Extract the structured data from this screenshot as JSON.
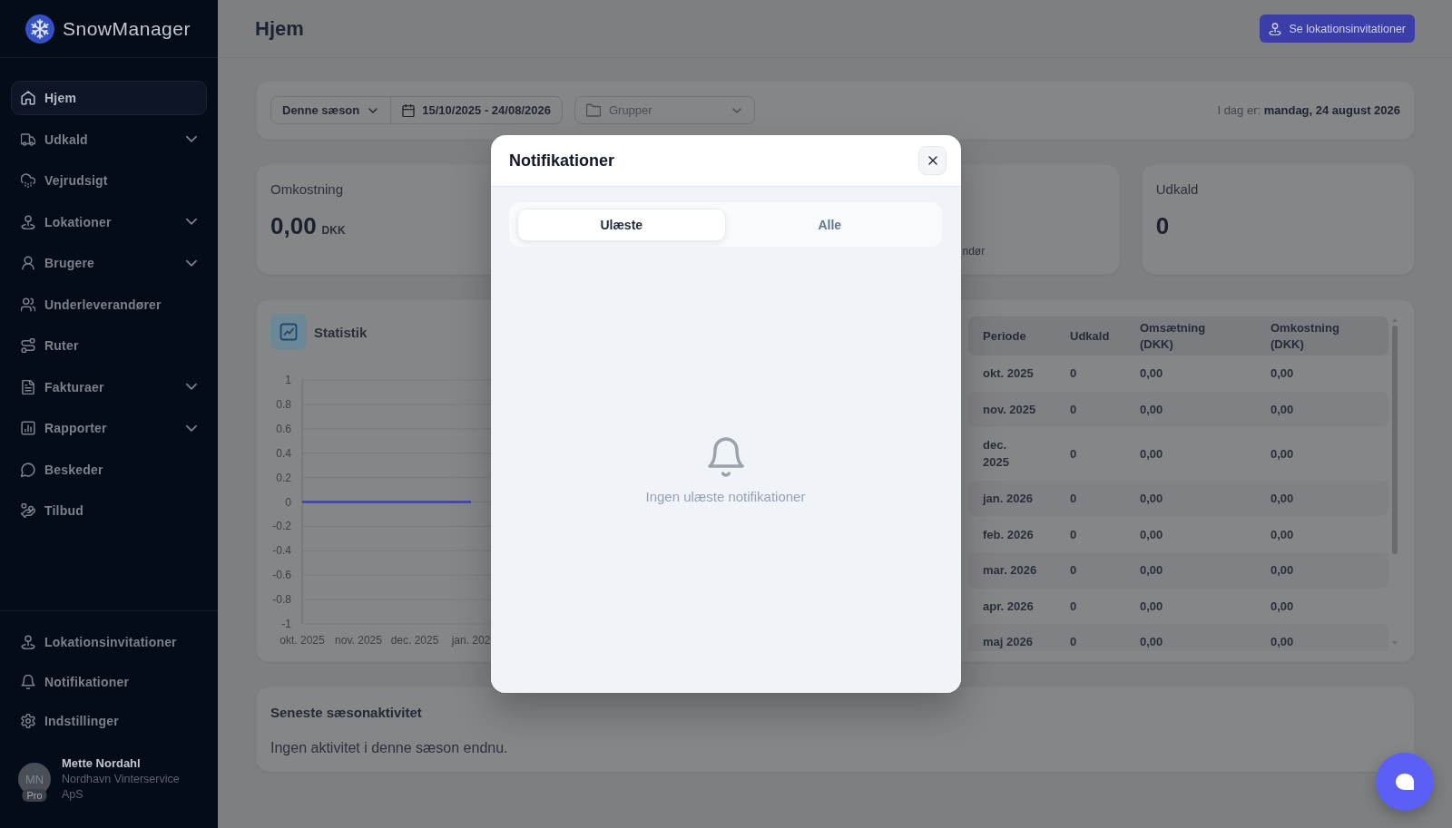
{
  "sidebar": {
    "brand": "SnowManager",
    "nav": [
      {
        "label": "Hjem",
        "selected": true,
        "has_submenu": false
      },
      {
        "label": "Udkald",
        "selected": false,
        "has_submenu": true
      },
      {
        "label": "Vejrudsigt",
        "selected": false,
        "has_submenu": false
      },
      {
        "label": "Lokationer",
        "selected": false,
        "has_submenu": true
      },
      {
        "label": "Brugere",
        "selected": false,
        "has_submenu": true
      },
      {
        "label": "Underleverandører",
        "selected": false,
        "has_submenu": false
      },
      {
        "label": "Ruter",
        "selected": false,
        "has_submenu": false
      },
      {
        "label": "Fakturaer",
        "selected": false,
        "has_submenu": true
      },
      {
        "label": "Rapporter",
        "selected": false,
        "has_submenu": true
      },
      {
        "label": "Beskeder",
        "selected": false,
        "has_submenu": false
      },
      {
        "label": "Tilbud",
        "selected": false,
        "has_submenu": false
      }
    ],
    "bottom_nav": [
      {
        "label": "Lokationsinvitationer",
        "selected": false
      },
      {
        "label": "Notifikationer",
        "selected": false
      },
      {
        "label": "Indstillinger",
        "selected": false
      }
    ],
    "user": {
      "initials": "MN",
      "plan": "Pro",
      "name": "Mette Nordahl",
      "company": "Nordhavn Vinterservice ApS"
    }
  },
  "header": {
    "title": "Hjem",
    "button": "Se lokationsinvitationer"
  },
  "filters": {
    "season": "Denne sæson",
    "date_range": "15/10/2025 - 24/08/2026",
    "groups": {
      "placeholder": "Grupper"
    },
    "today": "I dag er: **mandag, 24 august 2026**"
  },
  "stats": [
    {
      "title": "Omkostning",
      "value": "0,00",
      "unit": "DKK"
    },
    {
      "subtitle": "ndør"
    },
    {
      "title": "Udkald",
      "value": "0"
    }
  ],
  "statistics": {
    "title": "Statistik",
    "chart_data": {
      "type": "line",
      "categories": [
        "okt. 2025",
        "nov. 2025",
        "dec. 2025",
        "jan. 202"
      ],
      "series": [
        {
          "color": "#3b3fb4",
          "values": [
            0,
            0,
            0,
            0
          ]
        }
      ],
      "ylim": [
        -1,
        1
      ],
      "yticks": [
        1,
        0.8,
        0.6,
        0.4,
        0.2,
        0,
        -0.2,
        -0.4,
        -0.6,
        -0.8,
        -1
      ],
      "grid": true
    },
    "table": {
      "columns": [
        "Periode",
        "Udkald",
        "Omsætning (DKK)",
        "Omkostning (DKK)"
      ],
      "rows": [
        [
          "okt. 2025",
          "0",
          "0,00",
          "0,00"
        ],
        [
          "nov. 2025",
          "0",
          "0,00",
          "0,00"
        ],
        [
          "dec.\n2025",
          "0",
          "0,00",
          "0,00"
        ],
        [
          "jan. 2026",
          "0",
          "0,00",
          "0,00"
        ],
        [
          "feb. 2026",
          "0",
          "0,00",
          "0,00"
        ],
        [
          "mar. 2026",
          "0",
          "0,00",
          "0,00"
        ],
        [
          "apr. 2026",
          "0",
          "0,00",
          "0,00"
        ],
        [
          "maj 2026",
          "0",
          "0,00",
          "0,00"
        ]
      ]
    }
  },
  "activity": {
    "title": "Seneste sæsonaktivitet",
    "empty": "Ingen aktivitet i denne sæson endnu."
  },
  "modal": {
    "title": "Notifikationer",
    "tabs": [
      {
        "label": "Ulæste",
        "selected": true
      },
      {
        "label": "Alle",
        "selected": false
      }
    ],
    "empty": "Ingen ulæste notifikationer"
  }
}
